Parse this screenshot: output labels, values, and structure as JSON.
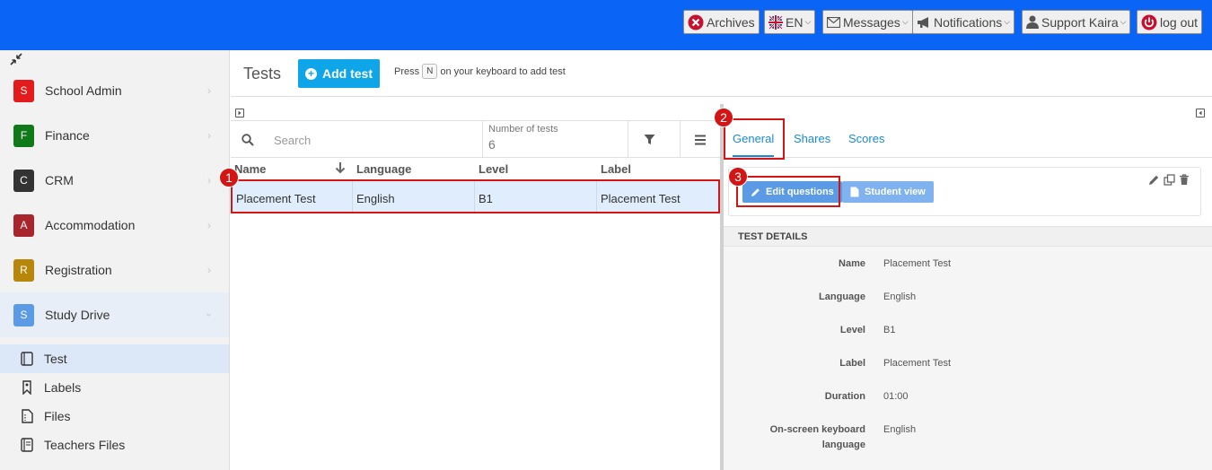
{
  "topbar": {
    "archives": "Archives",
    "language": "EN",
    "messages": "Messages",
    "notifications": "Notifications",
    "user": "Support Kaira",
    "logout": "log out"
  },
  "sidebar": {
    "items": [
      {
        "badge": "S",
        "label": "School Admin",
        "color": "#e31b1b"
      },
      {
        "badge": "F",
        "label": "Finance",
        "color": "#0f7a17"
      },
      {
        "badge": "C",
        "label": "CRM",
        "color": "#333333"
      },
      {
        "badge": "A",
        "label": "Accommodation",
        "color": "#a8252b"
      },
      {
        "badge": "R",
        "label": "Registration",
        "color": "#b8860b"
      },
      {
        "badge": "S",
        "label": "Study Drive",
        "color": "#5b9ae4"
      }
    ],
    "subitems": [
      {
        "label": "Test",
        "icon": "test-icon"
      },
      {
        "label": "Labels",
        "icon": "label-icon"
      },
      {
        "label": "Files",
        "icon": "file-icon"
      },
      {
        "label": "Teachers Files",
        "icon": "teacher-files-icon"
      }
    ]
  },
  "page": {
    "title": "Tests",
    "add_button": "Add test",
    "hint_pre": "Press",
    "hint_key": "N",
    "hint_post": "on your keyboard to add test"
  },
  "list": {
    "search_placeholder": "Search",
    "count_label": "Number of tests",
    "count_value": "6",
    "columns": [
      "Name",
      "Language",
      "Level",
      "Label"
    ],
    "rows": [
      {
        "name": "Placement Test",
        "language": "English",
        "level": "B1",
        "label": "Placement Test"
      }
    ]
  },
  "detail": {
    "tabs": [
      "General",
      "Shares",
      "Scores"
    ],
    "edit_questions": "Edit questions",
    "student_view": "Student view",
    "section_title": "TEST DETAILS",
    "fields": [
      {
        "label": "Name",
        "value": "Placement Test"
      },
      {
        "label": "Language",
        "value": "English"
      },
      {
        "label": "Level",
        "value": "B1"
      },
      {
        "label": "Label",
        "value": "Placement Test"
      },
      {
        "label": "Duration",
        "value": "01:00"
      },
      {
        "label": "On-screen keyboard language",
        "value": "English"
      }
    ]
  },
  "callouts": [
    "1",
    "2",
    "3"
  ],
  "colors": {
    "topbar": "#0a64f5",
    "accent": "#0ea5e9",
    "callout": "#d31515",
    "selected_row": "#e0edfc"
  }
}
